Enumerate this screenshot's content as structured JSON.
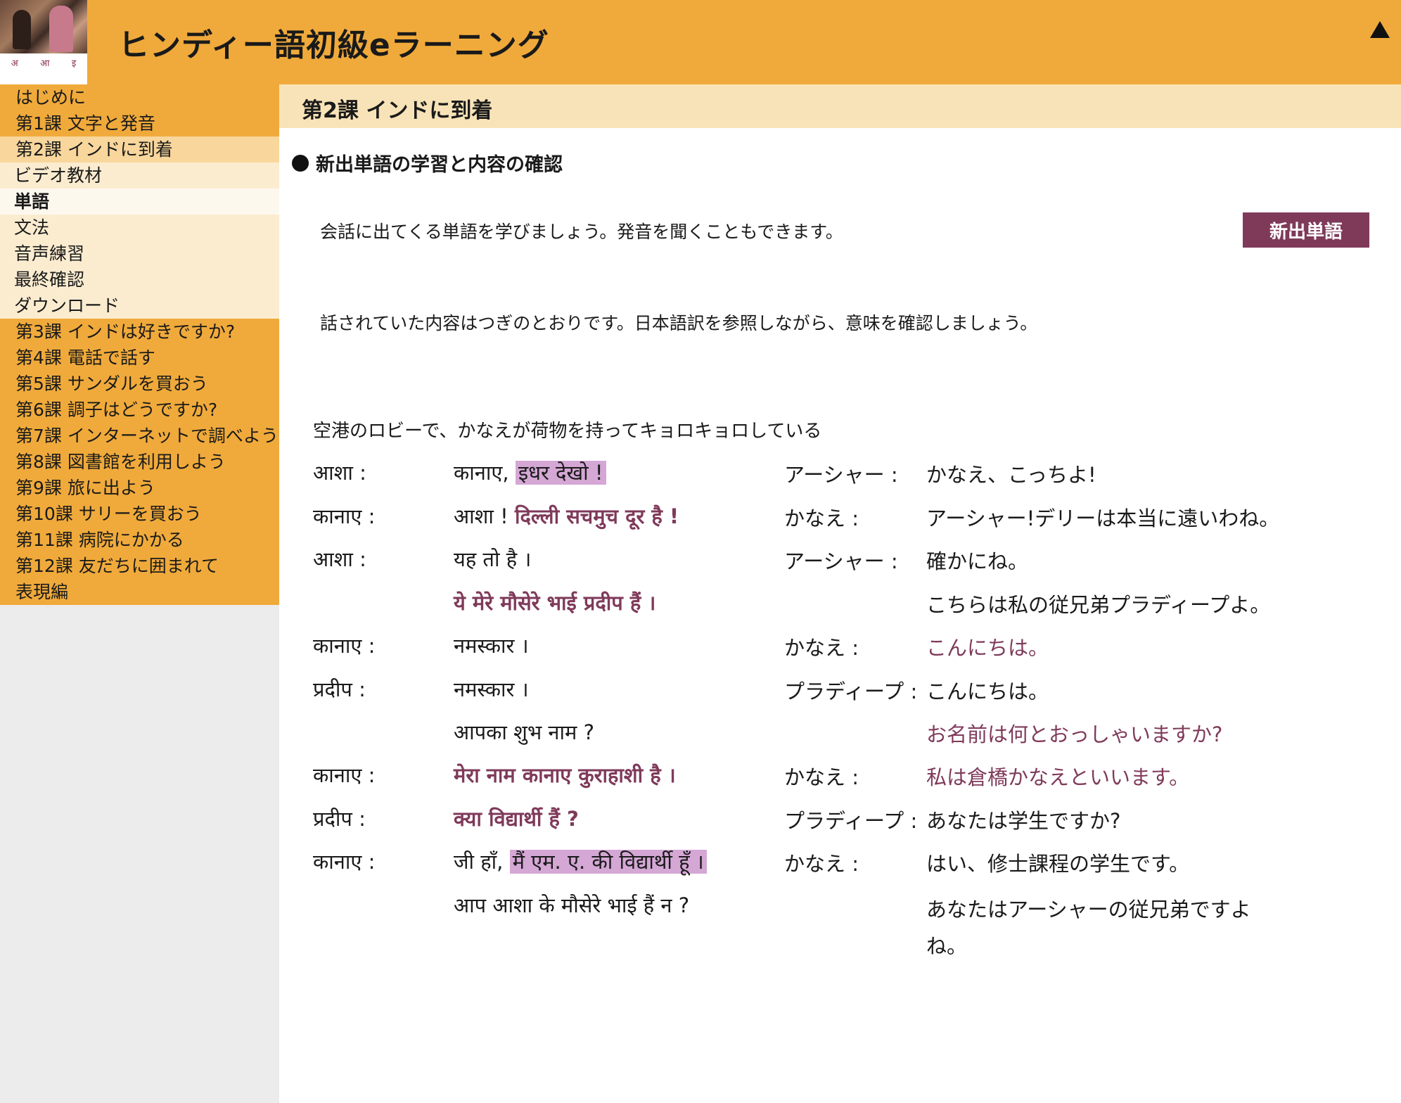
{
  "header": {
    "app_title": "ヒンディー語初級eラーニング",
    "logo_letters": [
      "अ",
      "आ",
      "इ"
    ]
  },
  "sidebar": {
    "items": [
      {
        "label": "はじめに",
        "type": "lesson"
      },
      {
        "label": "第1課 文字と発音",
        "type": "lesson"
      },
      {
        "label": "第2課 インドに到着",
        "type": "current"
      },
      {
        "label": "ビデオ教材",
        "type": "sub"
      },
      {
        "label": "単語",
        "type": "sub-active"
      },
      {
        "label": "文法",
        "type": "sub"
      },
      {
        "label": "音声練習",
        "type": "sub"
      },
      {
        "label": "最終確認",
        "type": "sub"
      },
      {
        "label": "ダウンロード",
        "type": "sub"
      },
      {
        "label": "第3課 インドは好きですか?",
        "type": "lesson"
      },
      {
        "label": "第4課 電話で話す",
        "type": "lesson"
      },
      {
        "label": "第5課 サンダルを買おう",
        "type": "lesson"
      },
      {
        "label": "第6課 調子はどうですか?",
        "type": "lesson"
      },
      {
        "label": "第7課 インターネットで調べよう",
        "type": "lesson"
      },
      {
        "label": "第8課 図書館を利用しよう",
        "type": "lesson"
      },
      {
        "label": "第9課 旅に出よう",
        "type": "lesson"
      },
      {
        "label": "第10課 サリーを買おう",
        "type": "lesson"
      },
      {
        "label": "第11課 病院にかかる",
        "type": "lesson"
      },
      {
        "label": "第12課 友だちに囲まれて",
        "type": "lesson"
      },
      {
        "label": "表現編",
        "type": "lesson"
      }
    ]
  },
  "main": {
    "lesson_title": "第2課 インドに到着",
    "section_heading": "新出単語の学習と内容の確認",
    "intro_text": "会話に出てくる単語を学びましょう。発音を聞くこともできます。",
    "new_words_button": "新出単語",
    "confirm_text": "話されていた内容はつぎのとおりです。日本語訳を参照しながら、意味を確認しましょう。",
    "scene_text": "空港のロビーで、かなえが荷物を持ってキョロキョロしている"
  },
  "dialogue": [
    {
      "speaker_hi": "आशा :",
      "hindi_plain": "कानाए, ",
      "hindi_hl": "इधर देखो !",
      "hindi_bold": "",
      "speaker_ja": "アーシャー :",
      "japanese": "かなえ、こっちよ!",
      "japanese_hl": ""
    },
    {
      "speaker_hi": "कानाए :",
      "hindi_plain": "आशा ! ",
      "hindi_hl": "",
      "hindi_bold": "दिल्ली सचमुच दूर है !",
      "speaker_ja": "かなえ :",
      "japanese": "アーシャー!デリーは本当に遠いわね。",
      "japanese_hl": ""
    },
    {
      "speaker_hi": "आशा :",
      "hindi_plain": "यह तो है ।",
      "hindi_hl": "",
      "hindi_bold": "",
      "speaker_ja": "アーシャー :",
      "japanese": "確かにね。",
      "japanese_hl": ""
    },
    {
      "speaker_hi": "",
      "hindi_plain": "",
      "hindi_hl": "",
      "hindi_bold": "ये मेरे मौसेरे भाई प्रदीप हैं ।",
      "speaker_ja": "",
      "japanese": "こちらは私の従兄弟プラディープよ。",
      "japanese_hl": ""
    },
    {
      "speaker_hi": "कानाए :",
      "hindi_plain": "नमस्कार ।",
      "hindi_hl": "",
      "hindi_bold": "",
      "speaker_ja": "かなえ :",
      "japanese": "",
      "japanese_hl": "こんにちは。"
    },
    {
      "speaker_hi": "प्रदीप :",
      "hindi_plain": "नमस्कार ।",
      "hindi_hl": "",
      "hindi_bold": "",
      "speaker_ja": "プラディープ :",
      "japanese": "こんにちは。",
      "japanese_hl": ""
    },
    {
      "speaker_hi": "",
      "hindi_plain": "आपका शुभ नाम ?",
      "hindi_hl": "",
      "hindi_bold": "",
      "speaker_ja": "",
      "japanese": "",
      "japanese_hl": "お名前は何とおっしゃいますか?"
    },
    {
      "speaker_hi": "कानाए :",
      "hindi_plain": "",
      "hindi_hl": "",
      "hindi_bold": "मेरा नाम कानाए कुराहाशी है ।",
      "speaker_ja": "かなえ :",
      "japanese": "",
      "japanese_hl": "私は倉橋かなえといいます。"
    },
    {
      "speaker_hi": "प्रदीप :",
      "hindi_plain": "",
      "hindi_hl": "",
      "hindi_bold": "क्या विद्यार्थी हैं ?",
      "speaker_ja": "プラディープ :",
      "japanese": "あなたは学生ですか?",
      "japanese_hl": ""
    },
    {
      "speaker_hi": "कानाए :",
      "hindi_plain": "जी हाँ, ",
      "hindi_hl": "मैं एम. ए. की विद्यार्थी हूँ ।",
      "hindi_bold": "",
      "speaker_ja": "かなえ :",
      "japanese": "はい、修士課程の学生です。",
      "japanese_hl": ""
    },
    {
      "speaker_hi": "",
      "hindi_plain": "आप आशा के मौसेरे भाई हैं न ?",
      "hindi_hl": "",
      "hindi_bold": "",
      "speaker_ja": "",
      "japanese": "あなたはアーシャーの従兄弟ですよ",
      "japanese2": "ね。",
      "japanese_hl": ""
    }
  ],
  "colors": {
    "header_bg": "#f0aa3b",
    "lesson_bar_bg": "#f8e3b8",
    "accent_plum": "#7f3a5a",
    "highlight": "#d4a7d5"
  }
}
